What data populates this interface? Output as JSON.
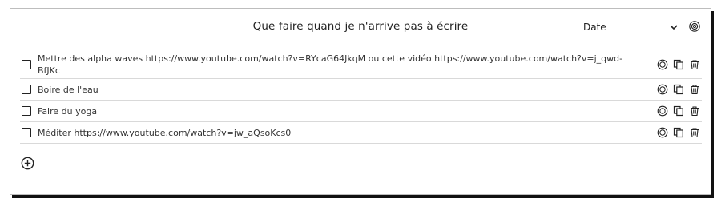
{
  "header": {
    "title": "Que faire quand je n'arrive pas à écrire",
    "sort_label": "Date"
  },
  "icons": {
    "sort": "chevron-down-icon",
    "settings": "gear-icon",
    "item_settings": "gear-icon",
    "item_duplicate": "copy-icon",
    "item_delete": "trash-icon",
    "add": "plus-circle-icon"
  },
  "items": [
    {
      "text": "Mettre des alpha waves https://www.youtube.com/watch?v=RYcaG64JkqM ou cette vidéo https://www.youtube.com/watch?v=j_qwd-BfJKc",
      "checked": false
    },
    {
      "text": "Boire de l'eau",
      "checked": false
    },
    {
      "text": "Faire du yoga",
      "checked": false
    },
    {
      "text": "Méditer https://www.youtube.com/watch?v=jw_aQsoKcs0",
      "checked": false
    }
  ]
}
